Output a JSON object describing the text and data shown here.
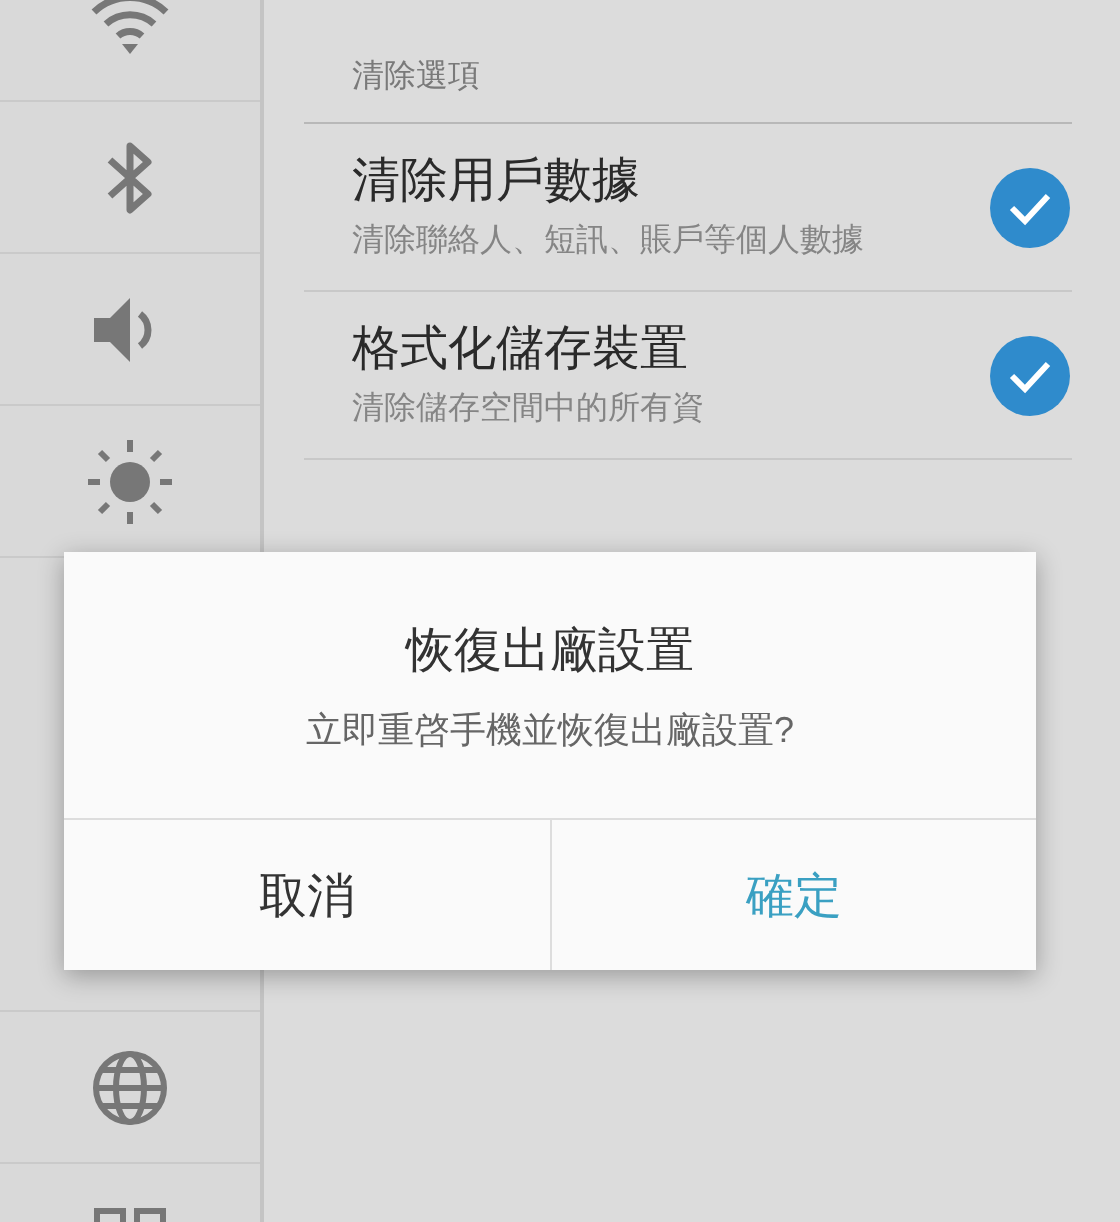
{
  "sidebar": {
    "items": [
      {
        "kind": "wifi"
      },
      {
        "kind": "bluetooth"
      },
      {
        "kind": "sound"
      },
      {
        "kind": "brightness"
      },
      {
        "kind": "globe"
      },
      {
        "kind": "grid"
      }
    ]
  },
  "section": {
    "header": "清除選項",
    "options": [
      {
        "title": "清除用戶數據",
        "subtitle": "清除聯絡人、短訊、賬戶等個人數據",
        "checked": true
      },
      {
        "title": "格式化儲存裝置",
        "subtitle": "清除儲存空間中的所有資",
        "checked": true
      }
    ]
  },
  "dialog": {
    "title": "恢復出廠設置",
    "message": "立即重啓手機並恢復出廠設置?",
    "buttons": [
      {
        "label": "取消",
        "kind": "cancel"
      },
      {
        "label": "確定",
        "kind": "confirm"
      }
    ]
  }
}
